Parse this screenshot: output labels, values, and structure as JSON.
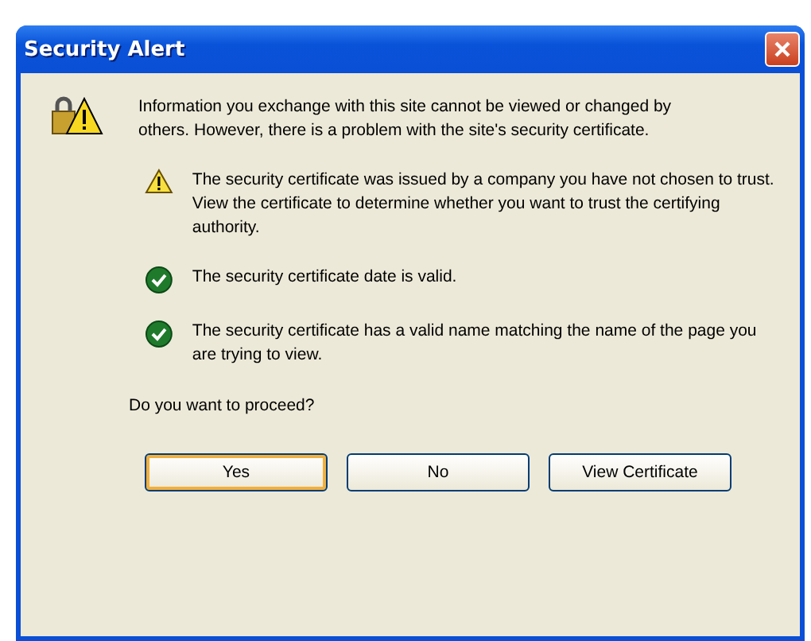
{
  "window": {
    "title": "Security Alert"
  },
  "message": "Information you exchange with this site cannot be viewed or changed by others. However, there is a problem with the site's security certificate.",
  "items": [
    {
      "kind": "warning",
      "text": "The security certificate was issued by a company you have not chosen to trust. View the certificate to determine whether you want to trust the certifying authority."
    },
    {
      "kind": "ok",
      "text": "The security certificate date is valid."
    },
    {
      "kind": "ok",
      "text": "The security certificate has a valid name matching the name of the page you are trying to view."
    }
  ],
  "question": "Do you want to proceed?",
  "buttons": [
    {
      "label": "Yes",
      "default": true
    },
    {
      "label": "No",
      "default": false
    },
    {
      "label": "View Certificate",
      "default": false
    }
  ]
}
